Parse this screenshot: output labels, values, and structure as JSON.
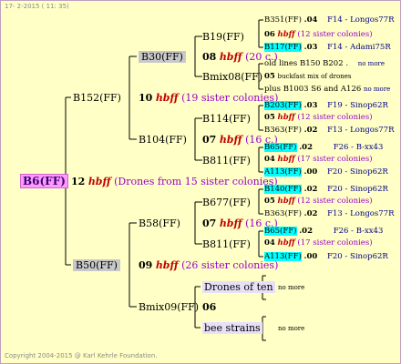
{
  "header": "17-  2-2015 ( 11: 35)",
  "footer": "Copyright 2004-2015 @ Karl Kehrle Foundation.",
  "root": {
    "label": "B6(FF)",
    "gen": "12",
    "hbff": "hbff",
    "note": "(Drones from 15 sister colonies)"
  },
  "gen1": [
    {
      "label": "B152(FF)",
      "gen": "10",
      "hbff": "hbff",
      "note": "(19 sister colonies)"
    },
    {
      "label": "B50(FF)",
      "gen": "09",
      "hbff": "hbff",
      "note": "(26 sister colonies)"
    }
  ],
  "gen2": {
    "b30": "B30(FF)",
    "b104": {
      "label": "B104(FF)",
      "gen": "07",
      "hbff": "hbff",
      "note": "(16 c.)"
    },
    "b58": {
      "label": "B58(FF)",
      "gen": "07",
      "hbff": "hbff",
      "note": "(16 c.)"
    },
    "bmix09": {
      "label": "Bmix09(FF)",
      "gen": "06"
    }
  },
  "b30_children": {
    "b19": "B19(FF)",
    "mid": {
      "gen": "08",
      "hbff": "hbff",
      "note": "(20 c.)"
    },
    "bmix08": "Bmix08(FF)"
  },
  "gen3": {
    "b114": "B114(FF)",
    "b811a": "B811(FF)",
    "b677": "B677(FF)",
    "b811b": "B811(FF)",
    "drones_of_ten": "Drones of ten",
    "bee_strains": "bee strains"
  },
  "leaves": [
    {
      "id": "B351(FF)",
      "num": ".04",
      "ref": "F14 - Longos77R"
    },
    {
      "gen": "06",
      "hbff": "hbff",
      "note": "(12 sister colonies)"
    },
    {
      "id": "B117(FF)",
      "num": ".03",
      "ref": "F14 - Adami75R"
    },
    {
      "text": "old lines B150 B202 .",
      "ref": "no more"
    },
    {
      "gen": "05",
      "note": "buckfast mix of drones"
    },
    {
      "text": "plus B1003 S6 and A126",
      "ref": "no more"
    },
    {
      "id": "B203(FF)",
      "num": ".03",
      "ref": "F19 - Sinop62R"
    },
    {
      "gen": "05",
      "hbff": "hbff",
      "note": "(12 sister colonies)"
    },
    {
      "id": "B363(FF)",
      "num": ".02",
      "ref": "F13 - Longos77R"
    },
    {
      "id": "B65(FF)",
      "num": ".02",
      "ref": "F26 - B-xx43"
    },
    {
      "gen": "04",
      "hbff": "hbff",
      "note": "(17 sister colonies)"
    },
    {
      "id": "A113(FF)",
      "num": ".00",
      "ref": "F20 - Sinop62R"
    },
    {
      "id": "B140(FF)",
      "num": ".02",
      "ref": "F20 - Sinop62R"
    },
    {
      "gen": "05",
      "hbff": "hbff",
      "note": "(12 sister colonies)"
    },
    {
      "id": "B363(FF)",
      "num": ".02",
      "ref": "F13 - Longos77R"
    },
    {
      "id": "B65(FF)",
      "num": ".02",
      "ref": "F26 - B-xx43"
    },
    {
      "gen": "04",
      "hbff": "hbff",
      "note": "(17 sister colonies)"
    },
    {
      "id": "A113(FF)",
      "num": ".00",
      "ref": "F20 - Sinop62R"
    }
  ],
  "no_more": "no more"
}
